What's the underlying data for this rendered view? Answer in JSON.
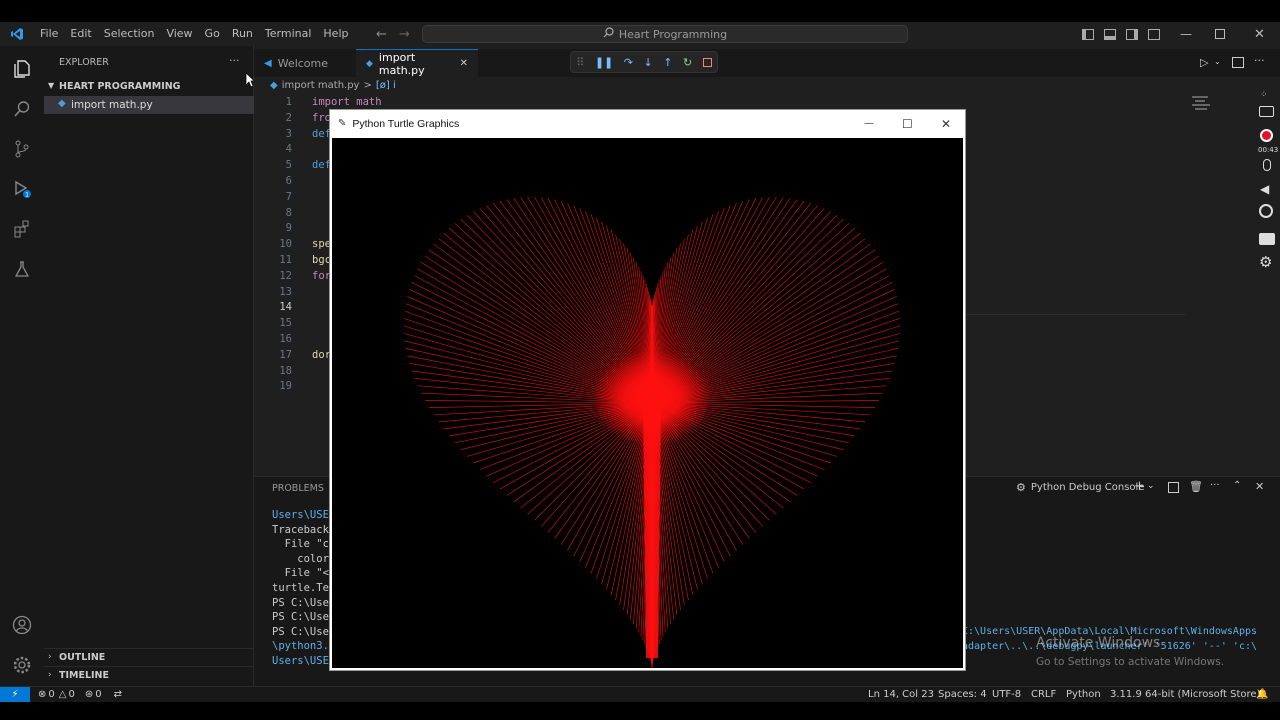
{
  "titlebar": {
    "menus": [
      "File",
      "Edit",
      "Selection",
      "View",
      "Go",
      "Run",
      "Terminal",
      "Help"
    ],
    "command_center": "Heart Programming"
  },
  "sidebar": {
    "title": "EXPLORER",
    "more": "···",
    "folder": "HEART PROGRAMMING",
    "file": "import math.py",
    "outline": "OUTLINE",
    "timeline": "TIMELINE"
  },
  "tabs": [
    {
      "label": "Welcome"
    },
    {
      "label": "import math.py",
      "close": "✕"
    }
  ],
  "breadcrumb": {
    "file": "import math.py",
    "sep": ">",
    "symbol": "[ø] i"
  },
  "editor": {
    "line_numbers": [
      "1",
      "2",
      "3",
      "4",
      "5",
      "6",
      "7",
      "8",
      "9",
      "10",
      "11",
      "12",
      "13",
      "14",
      "15",
      "16",
      "17",
      "18",
      "19"
    ],
    "code_lines": [
      {
        "line": "1",
        "text": "import math"
      },
      {
        "line": "2",
        "text": "fro"
      },
      {
        "line": "3",
        "text": "def"
      },
      {
        "line": "5",
        "text": "def"
      },
      {
        "line": "10",
        "text": "spe"
      },
      {
        "line": "11",
        "text": "bgc"
      },
      {
        "line": "12",
        "text": "for"
      },
      {
        "line": "17",
        "text": "dor"
      }
    ]
  },
  "turtle_window": {
    "title": "Python Turtle Graphics",
    "min": "—",
    "max": "☐",
    "close": "✕"
  },
  "panel": {
    "tab_problems": "PROBLEMS",
    "console_label": "Python Debug Console",
    "terminal_lines": [
      "Users\\USER",
      "Traceback",
      "  File \"c",
      "    color",
      "  File \"<",
      "turtle.Ter",
      "PS C:\\User",
      "PS C:\\User",
      "PS C:\\User",
      "\\python3.",
      "Users\\USE"
    ],
    "terminal_right_1": "C:\\Users\\USER\\AppData\\Local\\Microsoft\\WindowsApps",
    "terminal_right_2": "adapter\\..\\..\\debugpy\\launcher' '51626' '--' 'c:\\",
    "activate_title": "Activate Windows",
    "activate_sub": "Go to Settings to activate Windows."
  },
  "statusbar": {
    "remote": "⚡",
    "errors": "0",
    "warnings": "0",
    "ports": "0",
    "position": "Ln 14, Col 23",
    "spaces": "Spaces: 4",
    "encoding": "UTF-8",
    "eol": "CRLF",
    "language": "Python",
    "interpreter": "3.11.9 64-bit (Microsoft Store)"
  },
  "recorder": {
    "time": "00:43"
  },
  "colors": {
    "accent": "#0078d4",
    "heart": "#ff1010",
    "recorder_red": "#e81123"
  }
}
